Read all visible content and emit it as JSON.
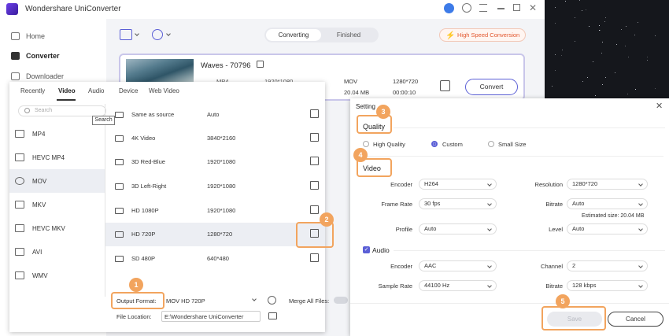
{
  "app": {
    "title": "Wondershare UniConverter"
  },
  "sidebar": {
    "items": [
      {
        "label": "Home",
        "icon": "home-icon"
      },
      {
        "label": "Converter",
        "icon": "converter-icon"
      },
      {
        "label": "Downloader",
        "icon": "downloader-icon"
      }
    ]
  },
  "toolbar": {
    "seg_converting": "Converting",
    "seg_finished": "Finished",
    "high_speed": "High Speed Conversion"
  },
  "file": {
    "name": "Waves - 70796",
    "src_format": "MP4",
    "src_res": "1920*1080",
    "dst_format": "MOV",
    "dst_res": "1280*720",
    "dst_size": "20.04 MB",
    "dst_time": "00:00:10",
    "convert_label": "Convert"
  },
  "format_panel": {
    "tabs": [
      "Recently",
      "Video",
      "Audio",
      "Device",
      "Web Video"
    ],
    "search_placeholder": "Search",
    "tooltip": "Search",
    "formats": [
      "MP4",
      "HEVC MP4",
      "MOV",
      "MKV",
      "HEVC MKV",
      "AVI",
      "WMV"
    ],
    "presets": [
      {
        "name": "Same as source",
        "res": "Auto"
      },
      {
        "name": "4K Video",
        "res": "3840*2160"
      },
      {
        "name": "3D Red-Blue",
        "res": "1920*1080"
      },
      {
        "name": "3D Left-Right",
        "res": "1920*1080"
      },
      {
        "name": "HD 1080P",
        "res": "1920*1080"
      },
      {
        "name": "HD 720P",
        "res": "1280*720"
      },
      {
        "name": "SD 480P",
        "res": "640*480"
      }
    ]
  },
  "bottom": {
    "output_format_label": "Output Format:",
    "output_format_value": "MOV HD 720P",
    "merge_label": "Merge All Files:",
    "file_location_label": "File Location:",
    "file_location_value": "E:\\Wondershare UniConverter"
  },
  "setting": {
    "title": "Setting",
    "quality_heading": "Quality",
    "quality_options": [
      "High Quality",
      "Custom",
      "Small Size"
    ],
    "video_heading": "Video",
    "encoder_label": "Encoder",
    "encoder_value": "H264",
    "resolution_label": "Resolution",
    "resolution_value": "1280*720",
    "framerate_label": "Frame Rate",
    "framerate_value": "30 fps",
    "bitrate_label": "Bitrate",
    "bitrate_value": "Auto",
    "estimated": "Estimated size: 20.04 MB",
    "profile_label": "Profile",
    "profile_value": "Auto",
    "level_label": "Level",
    "level_value": "Auto",
    "audio_heading": "Audio",
    "a_encoder_label": "Encoder",
    "a_encoder_value": "AAC",
    "channel_label": "Channel",
    "channel_value": "2",
    "samplerate_label": "Sample Rate",
    "samplerate_value": "44100 Hz",
    "a_bitrate_label": "Bitrate",
    "a_bitrate_value": "128 kbps",
    "save_label": "Save",
    "cancel_label": "Cancel"
  },
  "badges": [
    "1",
    "2",
    "3",
    "4",
    "5"
  ],
  "colors": {
    "accent": "#5b5fd6",
    "badge": "#f2a45e",
    "speed": "#e2562d"
  }
}
